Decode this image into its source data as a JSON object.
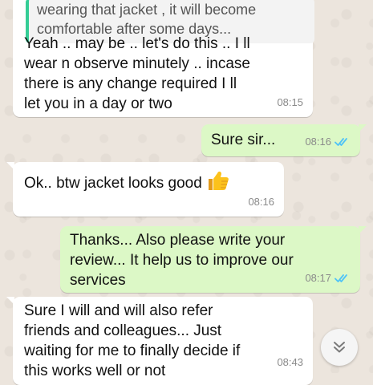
{
  "chat": {
    "quoted_message": {
      "text": "wearing that jacket , it will become\ncomfortable after some days..."
    },
    "messages": [
      {
        "direction": "incoming",
        "text": "Yeah .. may be .. let's do this .. I ll\nwear n observe minutely .. incase\nthere is any change required I ll\nlet you in a day or two",
        "time": "08:15"
      },
      {
        "direction": "outgoing",
        "text": "Sure sir...",
        "time": "08:16",
        "status": "read"
      },
      {
        "direction": "incoming",
        "text": "Ok.. btw jacket looks good",
        "emoji": "thumbs-up",
        "time": "08:16"
      },
      {
        "direction": "outgoing",
        "text": "Thanks... Also please write your\nreview... It help us to improve our\nservices",
        "time": "08:17",
        "status": "read"
      },
      {
        "direction": "incoming",
        "text": "Sure I will and will also refer\nfriends and colleagues... Just\nwaiting for me to finally decide if\nthis works well or not",
        "time": "08:43"
      }
    ]
  },
  "scroll_button": {
    "icon": "double-chevron-down-icon"
  },
  "colors": {
    "background": "#ece5dd",
    "incoming_bubble": "#ffffff",
    "outgoing_bubble": "#dcf8c6",
    "read_ticks": "#4fc3f7",
    "quote_bar": "#35cd96"
  }
}
